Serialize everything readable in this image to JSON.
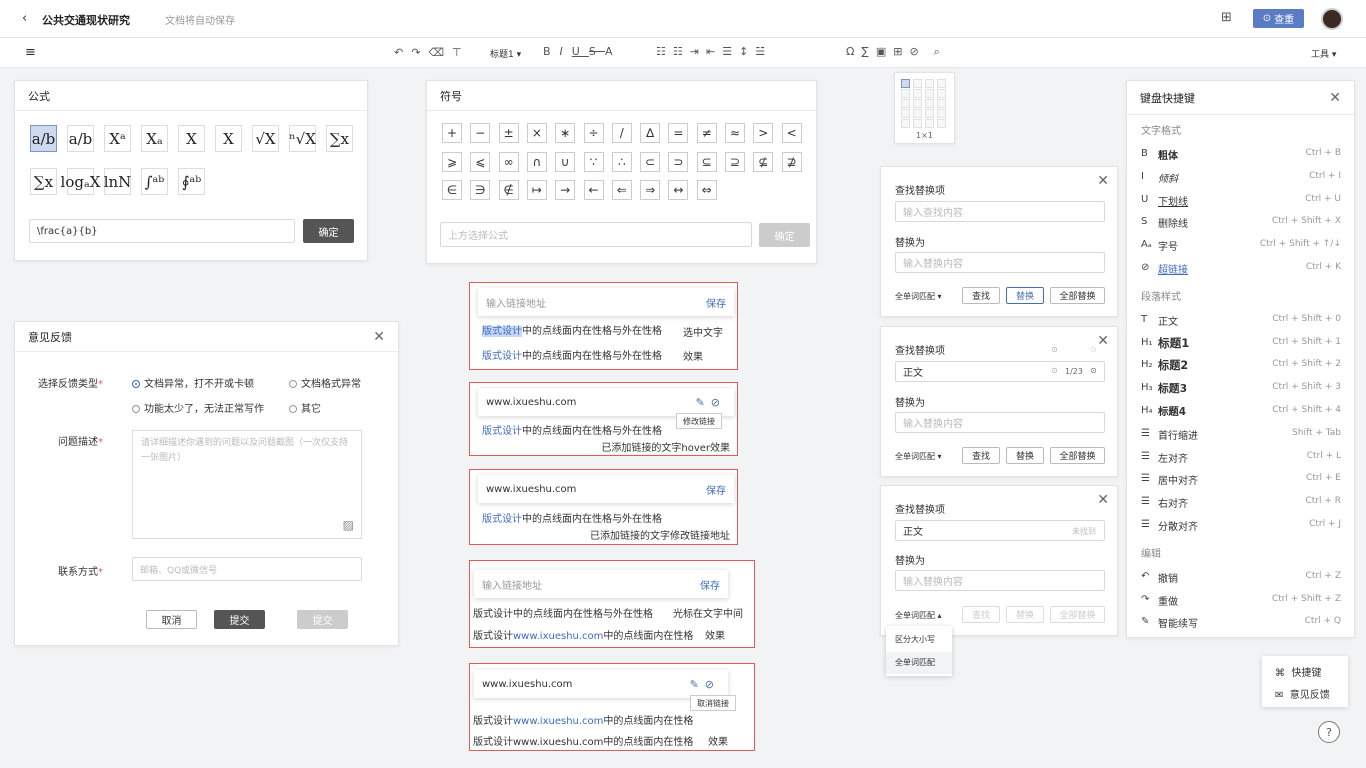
{
  "topbar": {
    "doc_title": "公共交通现状研究",
    "autosave": "文档将自动保存",
    "review_label": "查重"
  },
  "toolbar": {
    "heading_select": "标题1",
    "tools": "工具"
  },
  "formula": {
    "title": "公式",
    "input_value": "\\frac{a}{b}",
    "confirm": "确定",
    "items": [
      "a/b",
      "a/b",
      "Xᵃ",
      "Xₐ",
      "X",
      "X",
      "√X",
      "ⁿ√X",
      "∑x",
      "∑x",
      "logₐX",
      "lnN",
      "∫ᵃᵇ",
      "∮ᵃᵇ"
    ]
  },
  "symbols": {
    "title": "符号",
    "placeholder": "上方选择公式",
    "confirm": "确定",
    "items": [
      "+",
      "−",
      "±",
      "×",
      "∗",
      "÷",
      "/",
      "∆",
      "=",
      "≠",
      "≈",
      ">",
      "<",
      "⩾",
      "⩽",
      "∞",
      "∩",
      "∪",
      "∵",
      "∴",
      "⊂",
      "⊃",
      "⊆",
      "⊇",
      "⊈",
      "⊉",
      "∈",
      "∋",
      "∉",
      "↦",
      "→",
      "←",
      "⇐",
      "⇒",
      "↔",
      "⇔"
    ]
  },
  "table_picker": {
    "size": "1×1"
  },
  "feedback": {
    "title": "意见反馈",
    "type_label": "选择反馈类型",
    "options": [
      "文档异常，打不开或卡顿",
      "文档格式异常",
      "功能太少了，无法正常写作",
      "其它"
    ],
    "desc_label": "问题描述",
    "desc_placeholder": "请详细描述你遇到的问题以及问题截图（一次仅支持一张图片）",
    "contact_label": "联系方式",
    "contact_placeholder": "邮箱、QQ或微信号",
    "cancel": "取消",
    "submit": "提交",
    "submit2": "提交"
  },
  "link1": {
    "placeholder": "输入链接地址",
    "save": "保存",
    "line1_sel": "版式设计",
    "line1_rest": "中的点线面内在性格与外在性格",
    "note1": "选中文字",
    "line2_link": "版式设计",
    "line2_rest": "中的点线面内在性格与外在性格",
    "note2": "效果"
  },
  "link2": {
    "url": "www.ixueshu.com",
    "tooltip": "修改链接",
    "line1_link": "版式设计",
    "line1_rest": "中的点线面内在性格与外在性格",
    "note": "已添加链接的文字hover效果"
  },
  "link3": {
    "url": "www.ixueshu.com",
    "save": "保存",
    "line1_link": "版式设计",
    "line1_rest": "中的点线面内在性格与外在性格",
    "note": "已添加链接的文字修改链接地址"
  },
  "link4": {
    "placeholder": "输入链接地址",
    "save": "保存",
    "line1": "版式设计中的点线面内在性格与外在性格",
    "note1": "光标在文字中间",
    "line2_a": "版式设计",
    "line2_link": "www.ixueshu.com",
    "line2_b": "中的点线面内在性格",
    "note2": "效果"
  },
  "link5": {
    "url": "www.ixueshu.com",
    "tooltip": "取消链接",
    "line1_a": "版式设计",
    "line1_link": "www.ixueshu.com",
    "line1_b": "中的点线面内在性格",
    "line2": "版式设计www.ixueshu.com中的点线面内在性格",
    "note": "效果"
  },
  "find1": {
    "title": "查找替换项",
    "find_placeholder": "输入查找内容",
    "replace_label": "替换为",
    "replace_placeholder": "输入替换内容",
    "match": "全单词匹配",
    "find": "查找",
    "replace": "替换",
    "replace_all": "全部替换"
  },
  "find2": {
    "title": "查找替换项",
    "find_value": "正文",
    "count": "1/23",
    "replace_label": "替换为",
    "replace_placeholder": "输入替换内容",
    "match": "全单词匹配",
    "find": "查找",
    "replace": "替换",
    "replace_all": "全部替换"
  },
  "find3": {
    "title": "查找替换项",
    "find_value": "正文",
    "not_found": "未找到",
    "replace_label": "替换为",
    "replace_placeholder": "输入替换内容",
    "match": "全单词匹配",
    "find": "查找",
    "replace": "替换",
    "replace_all": "全部替换",
    "menu": [
      "区分大小写",
      "全单词匹配"
    ]
  },
  "shortcuts": {
    "title": "键盘快捷键",
    "sec1": "文字格式",
    "sec2": "段落样式",
    "sec3": "编辑",
    "rows1": [
      {
        "icon": "B",
        "label": "粗体",
        "keys": "Ctrl  +  B"
      },
      {
        "icon": "I",
        "label": "倾斜",
        "keys": "Ctrl  +  I"
      },
      {
        "icon": "U",
        "label": "下划线",
        "keys": "Ctrl  +  U"
      },
      {
        "icon": "S",
        "label": "删除线",
        "keys": "Ctrl  +  Shift  +  X"
      },
      {
        "icon": "Aₐ",
        "label": "字号",
        "keys": "Ctrl  +  Shift  +  ↑/↓"
      },
      {
        "icon": "⊘",
        "label": "超链接",
        "keys": "Ctrl  +  K"
      }
    ],
    "rows2": [
      {
        "icon": "T",
        "label": "正文",
        "keys": "Ctrl  +  Shift  +  0"
      },
      {
        "icon": "H₁",
        "label": "标题1",
        "keys": "Ctrl  +  Shift  +  1"
      },
      {
        "icon": "H₂",
        "label": "标题2",
        "keys": "Ctrl  +  Shift  +  2"
      },
      {
        "icon": "H₃",
        "label": "标题3",
        "keys": "Ctrl  +  Shift  +  3"
      },
      {
        "icon": "H₄",
        "label": "标题4",
        "keys": "Ctrl  +  Shift  +  4"
      },
      {
        "icon": "☰",
        "label": "首行缩进",
        "keys": "Shift  +  Tab"
      },
      {
        "icon": "☰",
        "label": "左对齐",
        "keys": "Ctrl  +  L"
      },
      {
        "icon": "☰",
        "label": "居中对齐",
        "keys": "Ctrl  +  E"
      },
      {
        "icon": "☰",
        "label": "右对齐",
        "keys": "Ctrl  +  R"
      },
      {
        "icon": "☰",
        "label": "分散对齐",
        "keys": "Ctrl  +  J"
      }
    ],
    "rows3": [
      {
        "icon": "↶",
        "label": "撤销",
        "keys": "Ctrl  +  Z"
      },
      {
        "icon": "↷",
        "label": "重做",
        "keys": "Ctrl  +  Shift  +  Z"
      },
      {
        "icon": "✎",
        "label": "智能续写",
        "keys": "Ctrl  +  Q"
      }
    ]
  },
  "help_menu": {
    "shortcut": "快捷键",
    "feedback": "意见反馈"
  }
}
